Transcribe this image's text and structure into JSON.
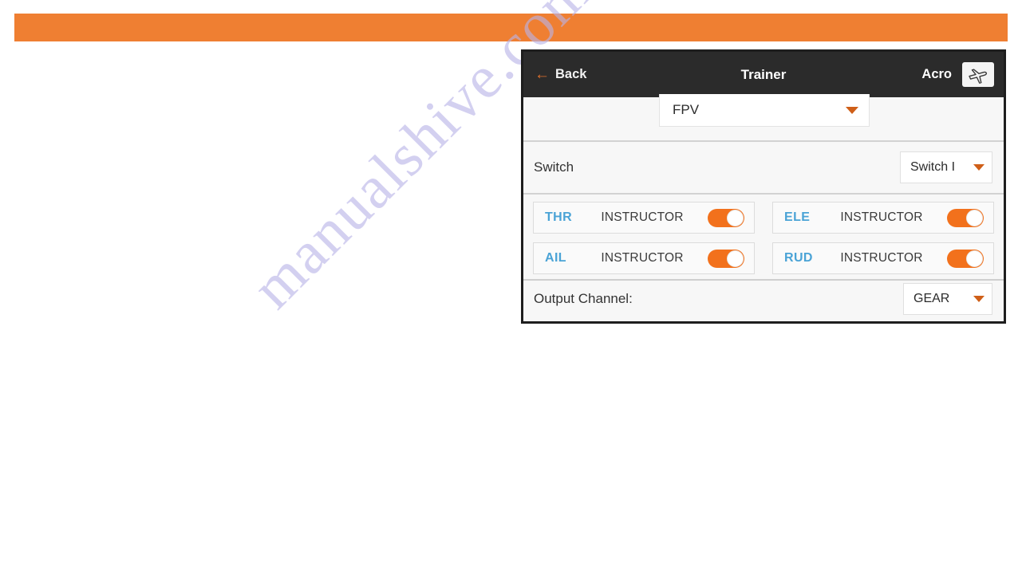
{
  "banner": {
    "color": "#ef7f32"
  },
  "watermark": {
    "text": "manualshive.com",
    "color": "#b9b4e8"
  },
  "panel": {
    "header": {
      "back_label": "Back",
      "back_icon": "arrow-left-icon",
      "title": "Trainer",
      "model_name": "Acro",
      "model_icon": "airplane-icon"
    },
    "mode_row": {
      "dropdown_value": "FPV",
      "caret_icon": "chevron-down-icon"
    },
    "switch_row": {
      "label": "Switch",
      "dropdown_value": "Switch I",
      "caret_icon": "chevron-down-icon"
    },
    "channels": [
      {
        "name": "THR",
        "mode": "INSTRUCTOR",
        "enabled": true
      },
      {
        "name": "ELE",
        "mode": "INSTRUCTOR",
        "enabled": true
      },
      {
        "name": "AIL",
        "mode": "INSTRUCTOR",
        "enabled": true
      },
      {
        "name": "RUD",
        "mode": "INSTRUCTOR",
        "enabled": true
      }
    ],
    "output_row": {
      "label": "Output Channel:",
      "dropdown_value": "GEAR",
      "caret_icon": "chevron-down-icon"
    },
    "colors": {
      "accent": "#f2711c",
      "channel_name": "#4aa3d6",
      "header_bg": "#2b2b2b",
      "caret": "#cf5f18"
    }
  }
}
